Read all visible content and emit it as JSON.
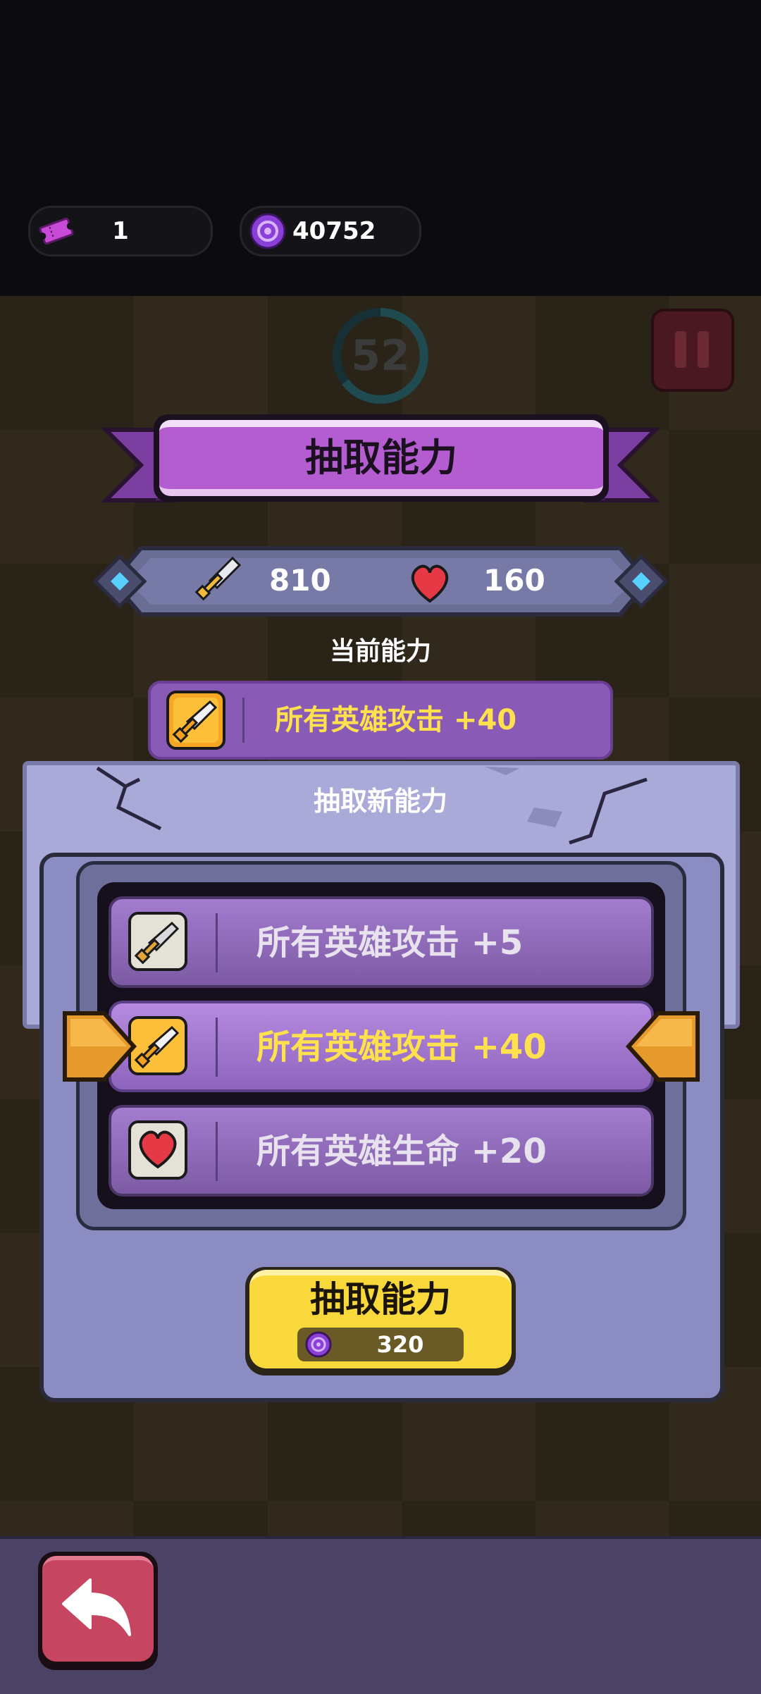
{
  "currency": {
    "tickets": "1",
    "orbs": "40752"
  },
  "timer": {
    "seconds": "52"
  },
  "popup": {
    "title": "抽取能力",
    "stats": {
      "attack": "810",
      "health": "160"
    },
    "current_label": "当前能力",
    "current_ability": "所有英雄攻击 +40",
    "draw_new_label": "抽取新能力",
    "options": [
      {
        "text": "所有英雄攻击 +5",
        "icon": "sword-icon",
        "highlighted": false
      },
      {
        "text": "所有英雄攻击 +40",
        "icon": "sword-icon",
        "highlighted": true
      },
      {
        "text": "所有英雄生命 +20",
        "icon": "heart-icon",
        "highlighted": false
      }
    ],
    "draw_button": {
      "label": "抽取能力",
      "cost": "320"
    }
  },
  "colors": {
    "accent_purple": "#b45dd0",
    "highlight_yellow": "#ffe14d",
    "button_yellow": "#f9d83c",
    "back_red": "#c64661"
  }
}
